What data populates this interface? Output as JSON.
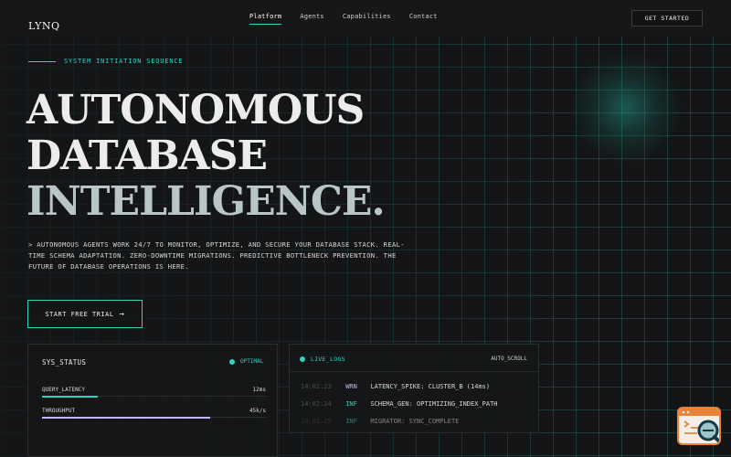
{
  "header": {
    "logo": "LYNQ",
    "nav": [
      {
        "label": "Platform",
        "active": true
      },
      {
        "label": "Agents",
        "active": false
      },
      {
        "label": "Capabilities",
        "active": false
      },
      {
        "label": "Contact",
        "active": false
      }
    ],
    "cta_label": "GET STARTED"
  },
  "hero": {
    "eyebrow": "SYSTEM INITIATION SEQUENCE",
    "headline_1": "AUTONOMOUS",
    "headline_2": "DATABASE",
    "headline_3": "INTELLIGENCE.",
    "description": "> AUTONOMOUS AGENTS WORK 24/7 TO MONITOR, OPTIMIZE, AND SECURE YOUR DATABASE STACK. REAL-TIME SCHEMA ADAPTATION. ZERO-DOWNTIME MIGRATIONS. PREDICTIVE BOTTLENECK PREVENTION. THE FUTURE OF DATABASE OPERATIONS IS HERE.",
    "trial_label": "START FREE TRIAL"
  },
  "status_panel": {
    "title": "SYS_STATUS",
    "state": "OPTIMAL",
    "metrics": [
      {
        "label": "QUERY_LATENCY",
        "value": "12ms",
        "fill_fraction": 0.25,
        "color": "#2dd4bf"
      },
      {
        "label": "THROUGHPUT",
        "value": "45k/s",
        "fill_fraction": 0.75,
        "color": "#c4b5fd"
      }
    ]
  },
  "logs_panel": {
    "title": "LIVE_LOGS",
    "auto_scroll": "AUTO_SCROLL",
    "entries": [
      {
        "time": "14:02:23",
        "level": "WRN",
        "message": "LATENCY_SPIKE: CLUSTER_B (14ms)",
        "level_color": "#c4b5fd"
      },
      {
        "time": "14:02:24",
        "level": "INF",
        "message": "SCHEMA_GEN: OPTIMIZING_INDEX_PATH",
        "level_color": "#2dd4bf"
      },
      {
        "time": "14:02:25",
        "level": "INF",
        "message": "MIGRATOR: SYNC_COMPLETE",
        "level_color": "#2dd4bf"
      }
    ]
  },
  "colors": {
    "accent": "#2dd4bf",
    "secondary": "#c4b5fd",
    "background": "#141516",
    "widget_border": "#e8833a"
  },
  "icons": {
    "trial_arrow": "arrow-right-icon",
    "status_dot": "status-dot-icon",
    "widget": "code-search-icon"
  }
}
